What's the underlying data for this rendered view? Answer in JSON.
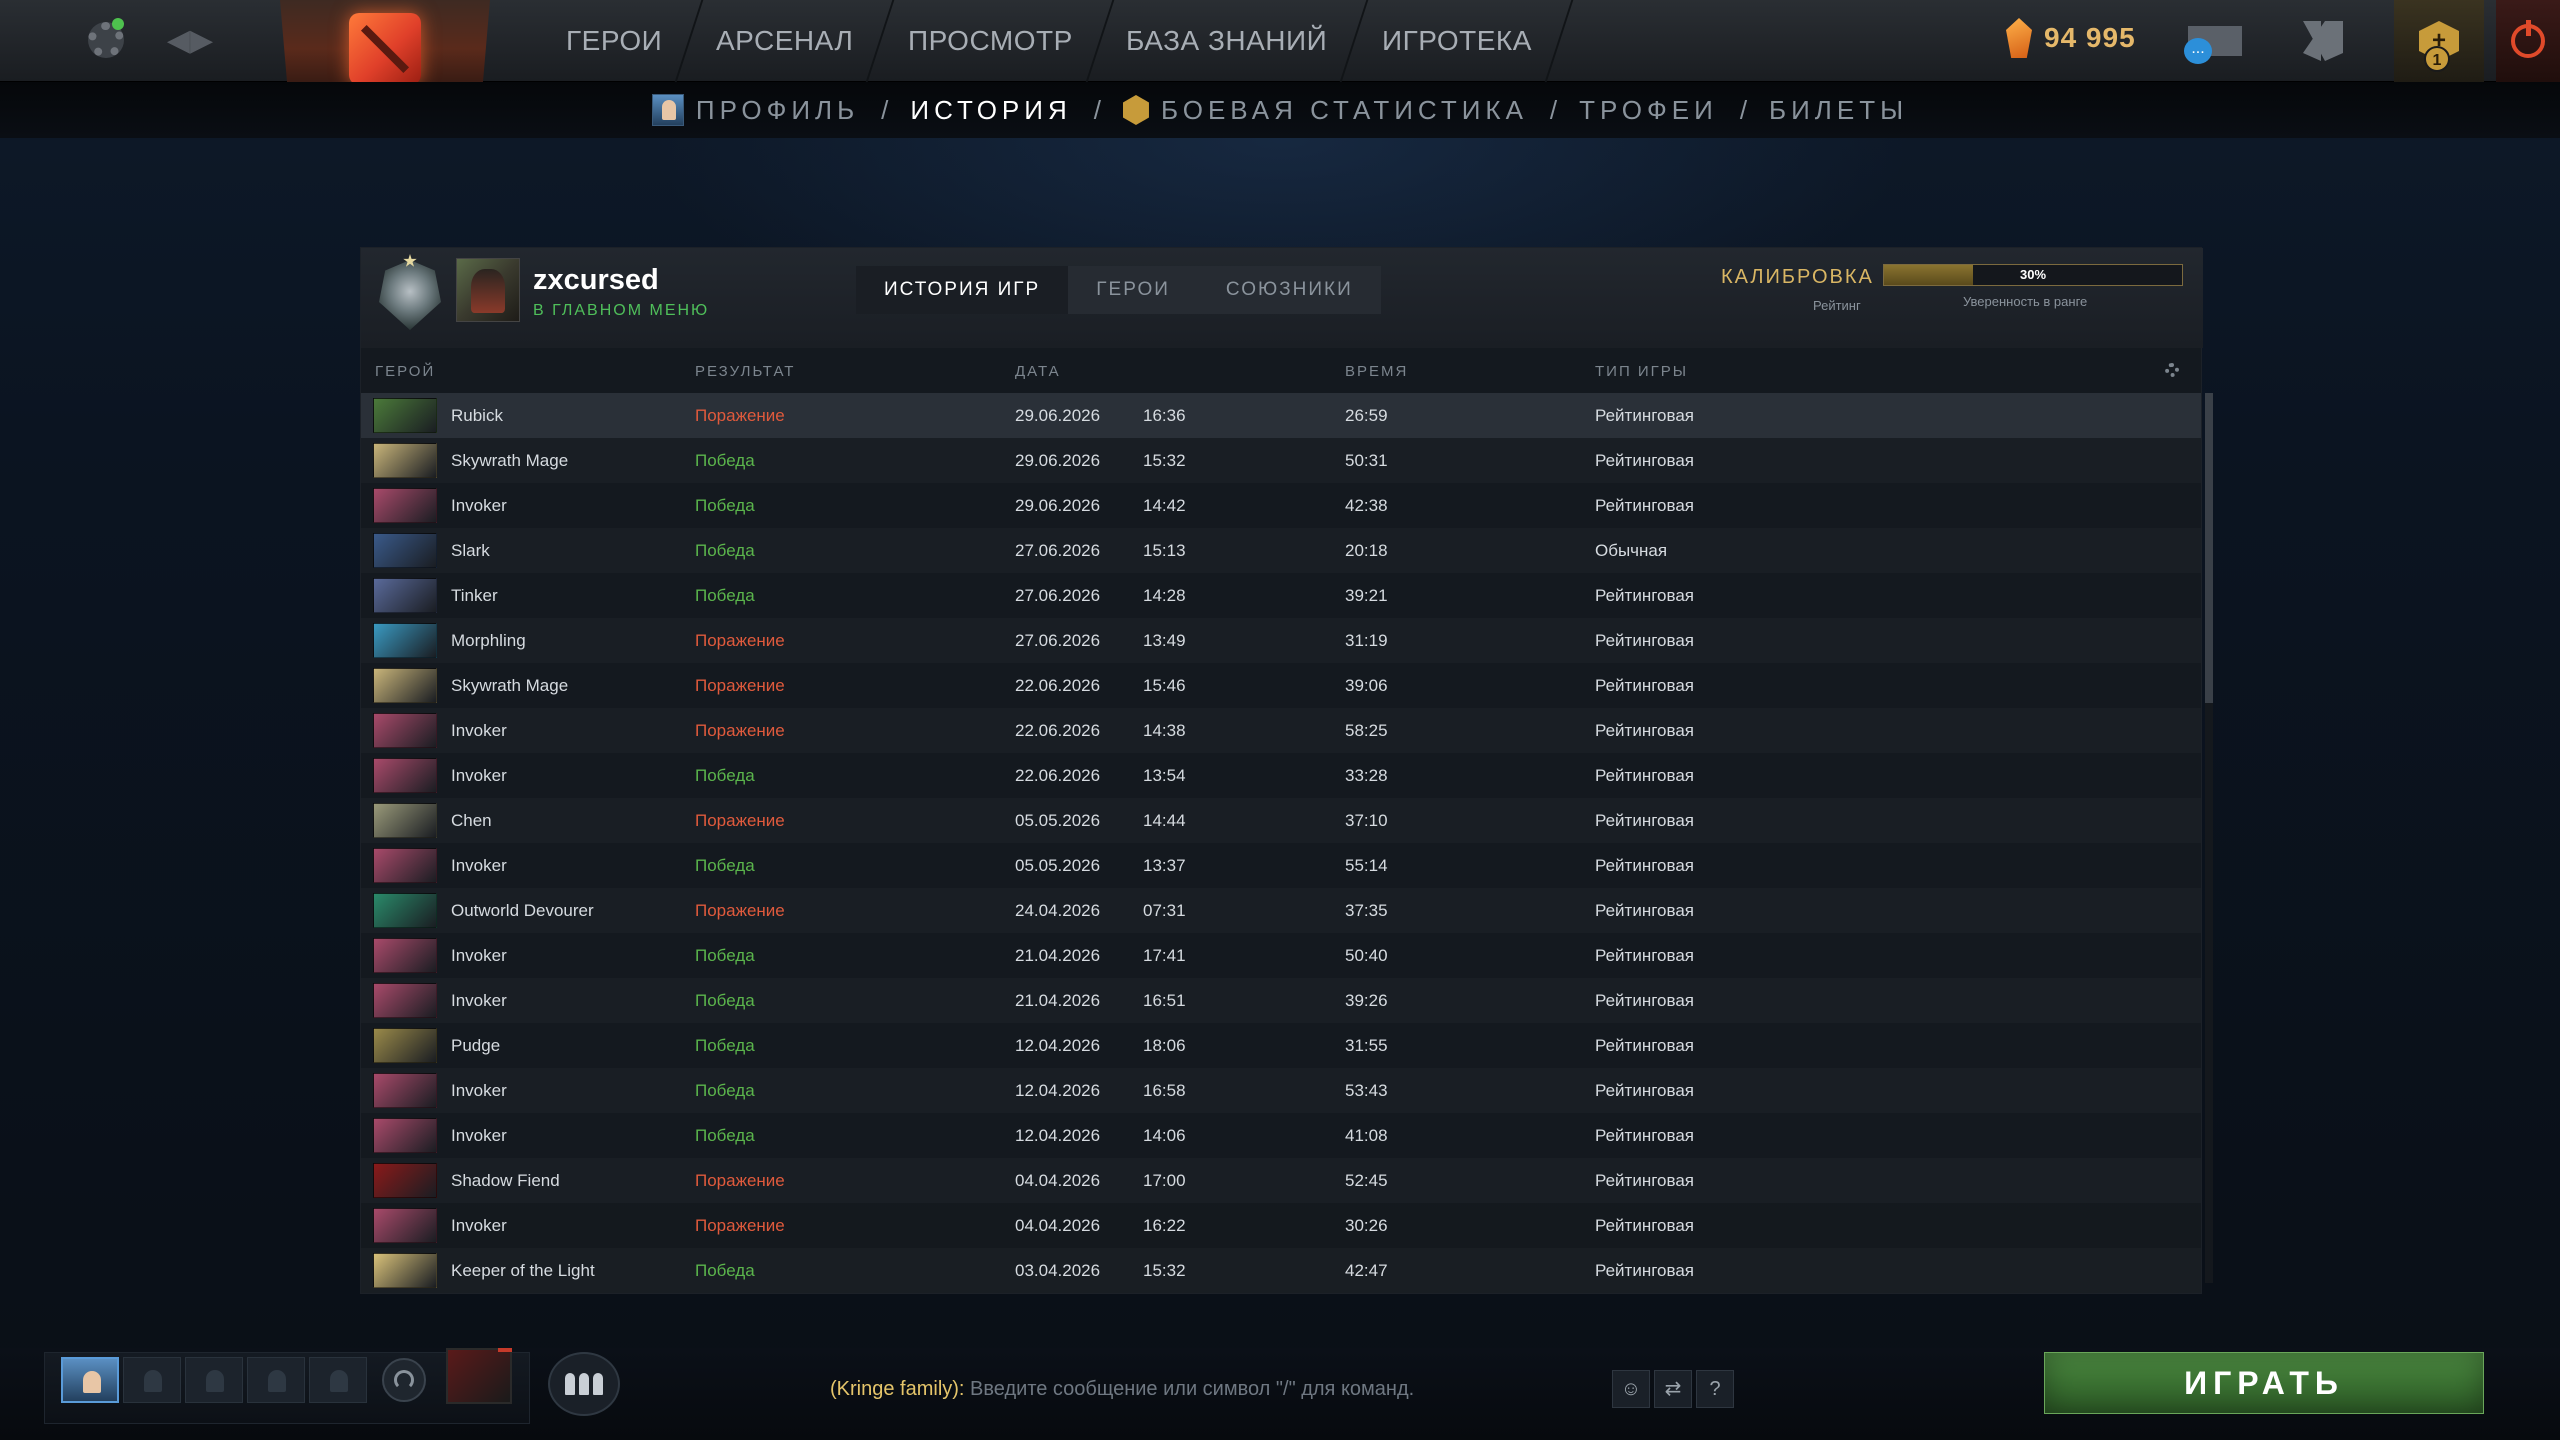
{
  "topbar": {
    "nav": [
      "ГЕРОИ",
      "АРСЕНАЛ",
      "ПРОСМОТР",
      "БАЗА ЗНАНИЙ",
      "ИГРОТЕКА"
    ],
    "shards": "94 995",
    "chat_badge": "...",
    "plus_count": "1"
  },
  "subnav": {
    "items": [
      "ПРОФИЛЬ",
      "ИСТОРИЯ",
      "БОЕВАЯ СТАТИСТИКА",
      "ТРОФЕИ",
      "БИЛЕТЫ"
    ],
    "separator": "/"
  },
  "profile": {
    "name": "zxcursed",
    "status": "В ГЛАВНОМ МЕНЮ",
    "tabs": [
      "ИСТОРИЯ ИГР",
      "ГЕРОИ",
      "СОЮЗНИКИ"
    ],
    "calibration_label": "КАЛИБРОВКА",
    "rating_label": "Рейтинг",
    "confidence_pct": "30%",
    "confidence_value": 30,
    "confidence_label": "Уверенность в ранге"
  },
  "columns": {
    "hero": "ГЕРОЙ",
    "result": "РЕЗУЛЬТАТ",
    "date": "ДАТА",
    "duration": "ВРЕМЯ",
    "mode": "ТИП ИГРЫ"
  },
  "matches": [
    {
      "hero": "Rubick",
      "result": "Поражение",
      "win": false,
      "date": "29.06.2026",
      "time": "16:36",
      "duration": "26:59",
      "mode": "Рейтинговая",
      "color": "#4b7a3a"
    },
    {
      "hero": "Skywrath Mage",
      "result": "Победа",
      "win": true,
      "date": "29.06.2026",
      "time": "15:32",
      "duration": "50:31",
      "mode": "Рейтинговая",
      "color": "#c9b57a"
    },
    {
      "hero": "Invoker",
      "result": "Победа",
      "win": true,
      "date": "29.06.2026",
      "time": "14:42",
      "duration": "42:38",
      "mode": "Рейтинговая",
      "color": "#a84a6a"
    },
    {
      "hero": "Slark",
      "result": "Победа",
      "win": true,
      "date": "27.06.2026",
      "time": "15:13",
      "duration": "20:18",
      "mode": "Обычная",
      "color": "#3a5a8a"
    },
    {
      "hero": "Tinker",
      "result": "Победа",
      "win": true,
      "date": "27.06.2026",
      "time": "14:28",
      "duration": "39:21",
      "mode": "Рейтинговая",
      "color": "#5a6a9a"
    },
    {
      "hero": "Morphling",
      "result": "Поражение",
      "win": false,
      "date": "27.06.2026",
      "time": "13:49",
      "duration": "31:19",
      "mode": "Рейтинговая",
      "color": "#3a9ac2"
    },
    {
      "hero": "Skywrath Mage",
      "result": "Поражение",
      "win": false,
      "date": "22.06.2026",
      "time": "15:46",
      "duration": "39:06",
      "mode": "Рейтинговая",
      "color": "#c9b57a"
    },
    {
      "hero": "Invoker",
      "result": "Поражение",
      "win": false,
      "date": "22.06.2026",
      "time": "14:38",
      "duration": "58:25",
      "mode": "Рейтинговая",
      "color": "#a84a6a"
    },
    {
      "hero": "Invoker",
      "result": "Победа",
      "win": true,
      "date": "22.06.2026",
      "time": "13:54",
      "duration": "33:28",
      "mode": "Рейтинговая",
      "color": "#a84a6a"
    },
    {
      "hero": "Chen",
      "result": "Поражение",
      "win": false,
      "date": "05.05.2026",
      "time": "14:44",
      "duration": "37:10",
      "mode": "Рейтинговая",
      "color": "#9a9a7a"
    },
    {
      "hero": "Invoker",
      "result": "Победа",
      "win": true,
      "date": "05.05.2026",
      "time": "13:37",
      "duration": "55:14",
      "mode": "Рейтинговая",
      "color": "#a84a6a"
    },
    {
      "hero": "Outworld Devourer",
      "result": "Поражение",
      "win": false,
      "date": "24.04.2026",
      "time": "07:31",
      "duration": "37:35",
      "mode": "Рейтинговая",
      "color": "#2a8a6a"
    },
    {
      "hero": "Invoker",
      "result": "Победа",
      "win": true,
      "date": "21.04.2026",
      "time": "17:41",
      "duration": "50:40",
      "mode": "Рейтинговая",
      "color": "#a84a6a"
    },
    {
      "hero": "Invoker",
      "result": "Победа",
      "win": true,
      "date": "21.04.2026",
      "time": "16:51",
      "duration": "39:26",
      "mode": "Рейтинговая",
      "color": "#a84a6a"
    },
    {
      "hero": "Pudge",
      "result": "Победа",
      "win": true,
      "date": "12.04.2026",
      "time": "18:06",
      "duration": "31:55",
      "mode": "Рейтинговая",
      "color": "#9a8a4a"
    },
    {
      "hero": "Invoker",
      "result": "Победа",
      "win": true,
      "date": "12.04.2026",
      "time": "16:58",
      "duration": "53:43",
      "mode": "Рейтинговая",
      "color": "#a84a6a"
    },
    {
      "hero": "Invoker",
      "result": "Победа",
      "win": true,
      "date": "12.04.2026",
      "time": "14:06",
      "duration": "41:08",
      "mode": "Рейтинговая",
      "color": "#a84a6a"
    },
    {
      "hero": "Shadow Fiend",
      "result": "Поражение",
      "win": false,
      "date": "04.04.2026",
      "time": "17:00",
      "duration": "52:45",
      "mode": "Рейтинговая",
      "color": "#8a1a1a"
    },
    {
      "hero": "Invoker",
      "result": "Поражение",
      "win": false,
      "date": "04.04.2026",
      "time": "16:22",
      "duration": "30:26",
      "mode": "Рейтинговая",
      "color": "#a84a6a"
    },
    {
      "hero": "Keeper of the Light",
      "result": "Победа",
      "win": true,
      "date": "03.04.2026",
      "time": "15:32",
      "duration": "42:47",
      "mode": "Рейтинговая",
      "color": "#d9c27a"
    }
  ],
  "bottom": {
    "chat_channel": "(Kringe family):",
    "chat_placeholder": "Введите сообщение или символ \"/\" для команд.",
    "help": "?",
    "play": "ИГРАТЬ"
  },
  "colors": {
    "win": "#5bb54c",
    "loss": "#e05a3c",
    "accent_gold": "#d9b664",
    "play_green": "#3b7232"
  }
}
